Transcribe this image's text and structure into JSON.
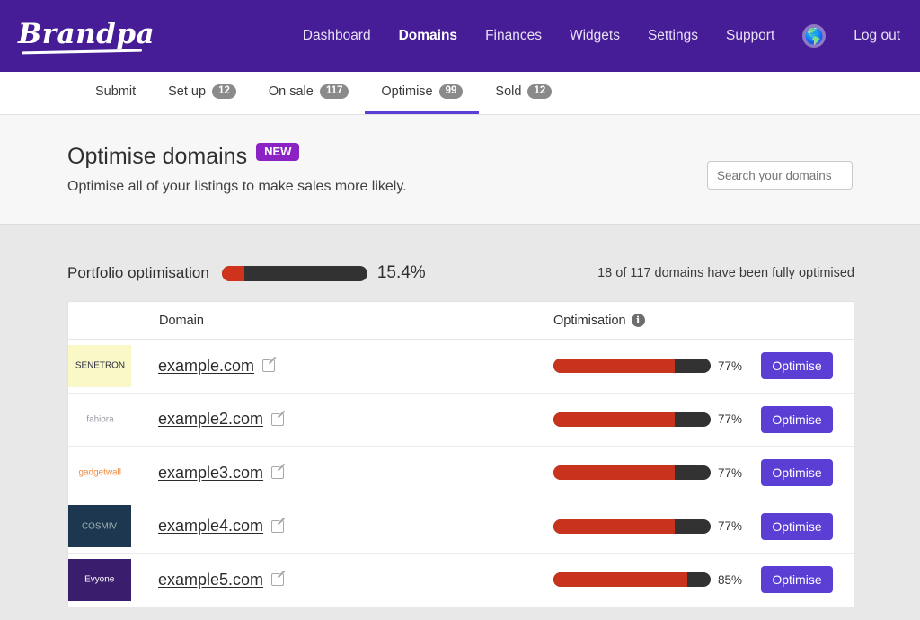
{
  "brand": {
    "name": "Brandpa"
  },
  "topnav": {
    "items": [
      {
        "label": "Dashboard",
        "active": false
      },
      {
        "label": "Domains",
        "active": true
      },
      {
        "label": "Finances",
        "active": false
      },
      {
        "label": "Widgets",
        "active": false
      },
      {
        "label": "Settings",
        "active": false
      },
      {
        "label": "Support",
        "active": false
      }
    ],
    "globe_icon": "globe-icon",
    "logout": "Log out"
  },
  "tabs": [
    {
      "label": "Submit",
      "count": "",
      "active": false
    },
    {
      "label": "Set up",
      "count": "12",
      "active": false
    },
    {
      "label": "On sale",
      "count": "117",
      "active": false
    },
    {
      "label": "Optimise",
      "count": "99",
      "active": true
    },
    {
      "label": "Sold",
      "count": "12",
      "active": false
    }
  ],
  "header": {
    "title": "Optimise domains",
    "badge": "NEW",
    "subtitle": "Optimise all of your listings to make sales more likely.",
    "search_placeholder": "Search your domains"
  },
  "portfolio": {
    "label": "Portfolio optimisation",
    "percent_text": "15.4%",
    "percent_value": 15.4,
    "note": "18 of 117 domains have been fully optimised"
  },
  "table": {
    "columns": {
      "logo": "",
      "domain": "Domain",
      "optimisation": "Optimisation",
      "info_icon": "info-icon",
      "action": ""
    },
    "rows": [
      {
        "domain": "example.com",
        "edit_icon": "edit-icon",
        "percent_text": "77%",
        "percent_value": 77,
        "button": "Optimise",
        "logo": {
          "text": "SENETRON",
          "bg": "#fbf8c8",
          "fg": "#2b2b3d"
        }
      },
      {
        "domain": "example2.com",
        "edit_icon": "edit-icon",
        "percent_text": "77%",
        "percent_value": 77,
        "button": "Optimise",
        "logo": {
          "text": "fahiora",
          "bg": "#ffffff",
          "fg": "#9a9aa5"
        }
      },
      {
        "domain": "example3.com",
        "edit_icon": "edit-icon",
        "percent_text": "77%",
        "percent_value": 77,
        "button": "Optimise",
        "logo": {
          "text": "gadgetwall",
          "bg": "#ffffff",
          "fg": "#f08a3c"
        }
      },
      {
        "domain": "example4.com",
        "edit_icon": "edit-icon",
        "percent_text": "77%",
        "percent_value": 77,
        "button": "Optimise",
        "logo": {
          "text": "COSMIV",
          "bg": "#1d3750",
          "fg": "#9fb3b0"
        }
      },
      {
        "domain": "example5.com",
        "edit_icon": "edit-icon",
        "percent_text": "85%",
        "percent_value": 85,
        "button": "Optimise",
        "logo": {
          "text": "Evyone",
          "bg": "#3b1d6e",
          "fg": "#ffffff"
        }
      }
    ]
  },
  "colors": {
    "header_purple": "#461d96",
    "accent_indigo": "#5b3fd4",
    "badge_purple": "#8b23c4",
    "bar_red": "#c8331d",
    "bar_track": "#323232",
    "page_bg": "#e8e8e8"
  }
}
